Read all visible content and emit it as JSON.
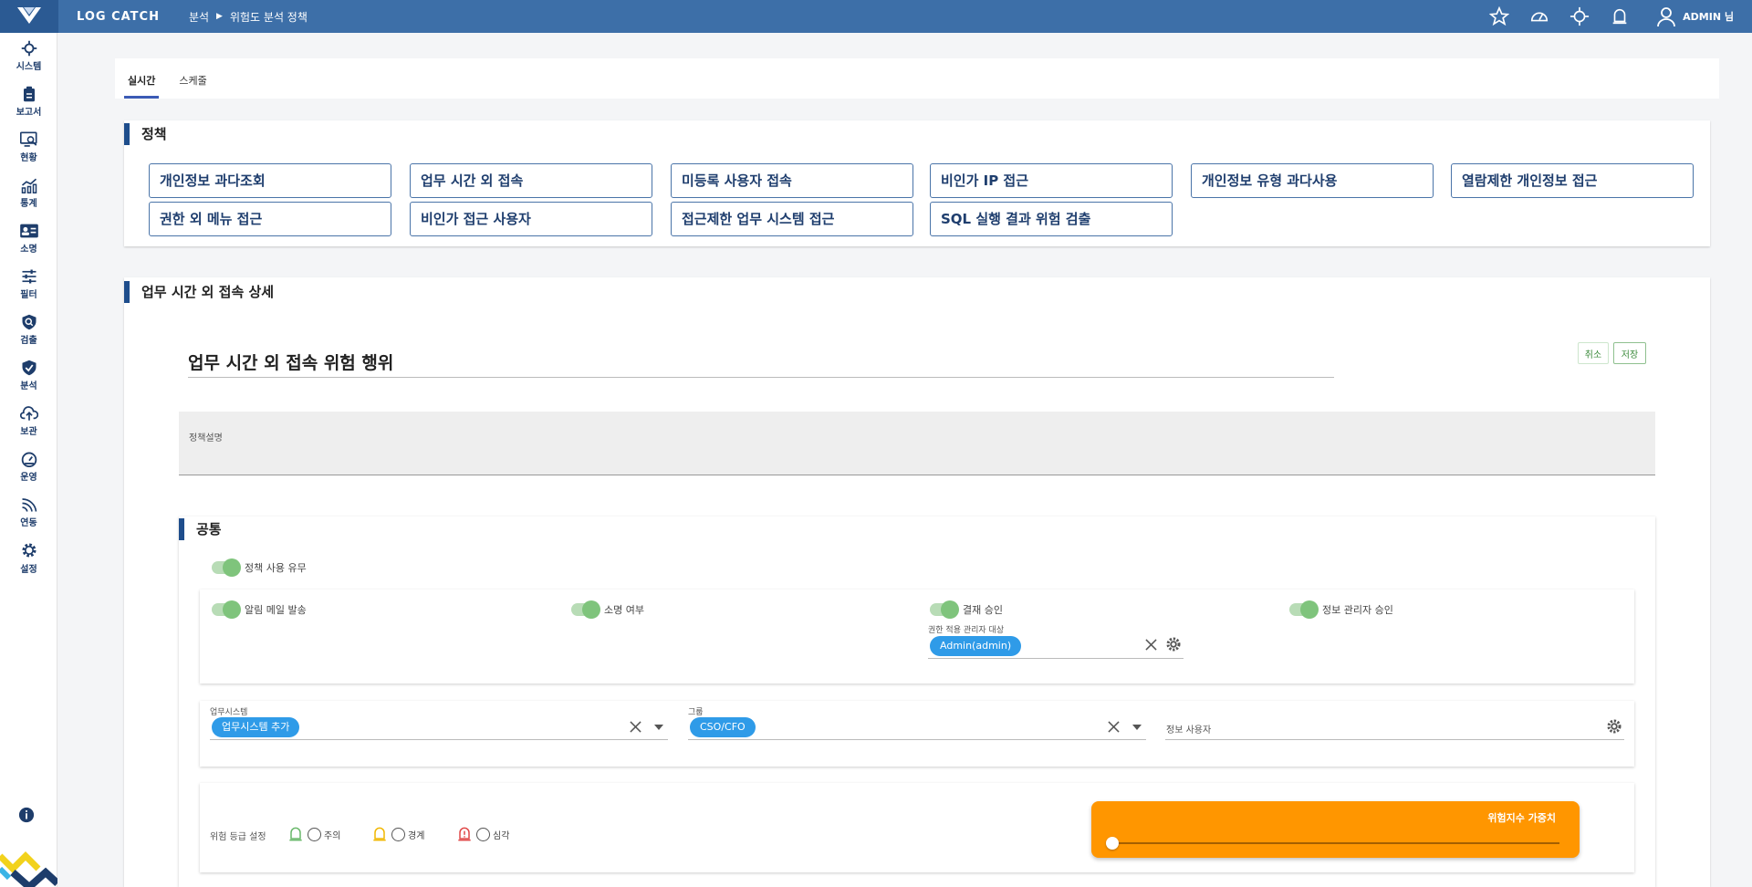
{
  "header": {
    "brand": "LOG CATCH",
    "breadcrumb": [
      "분석",
      "위험도 분석 정책"
    ],
    "user": "ADMIN 님"
  },
  "sidebar": {
    "items": [
      {
        "label": "시스템",
        "icon": "crosshair-icon"
      },
      {
        "label": "보고서",
        "icon": "clipboard-icon"
      },
      {
        "label": "현황",
        "icon": "monitor-search-icon"
      },
      {
        "label": "통계",
        "icon": "chart-icon"
      },
      {
        "label": "소명",
        "icon": "id-card-icon"
      },
      {
        "label": "필터",
        "icon": "sliders-icon"
      },
      {
        "label": "검출",
        "icon": "shield-search-icon"
      },
      {
        "label": "분석",
        "icon": "shield-check-icon"
      },
      {
        "label": "보관",
        "icon": "cloud-upload-icon"
      },
      {
        "label": "운영",
        "icon": "gauge-icon"
      },
      {
        "label": "연동",
        "icon": "signal-icon"
      },
      {
        "label": "설정",
        "icon": "gear-icon"
      }
    ]
  },
  "tabs": [
    "실시간",
    "스케줄"
  ],
  "policy_section": {
    "title": "정책",
    "buttons": [
      "개인정보 과다조회",
      "업무 시간 외 접속",
      "미등록 사용자 접속",
      "비인가 IP 접근",
      "개인정보 유형 과다사용",
      "열람제한 개인정보 접근",
      "권한 외 메뉴 접근",
      "비인가 접근 사용자",
      "접근제한 업무 시스템 접근",
      "SQL 실행 결과 위험 검출"
    ]
  },
  "detail_section": {
    "title": "업무 시간 외 접속 상세",
    "policy_name": "업무 시간 외 접속 위험 행위",
    "cancel_label": "취소",
    "save_label": "저장",
    "description_placeholder": "정책설명"
  },
  "common_section": {
    "title": "공통",
    "policy_use": "정책 사용 유무",
    "toggles": [
      "알림 메일 발송",
      "소명 여부",
      "결재 승인",
      "정보 관리자 승인"
    ],
    "approver_label": "권한 적용 관리자 대상",
    "approver_chip": "Admin(admin)",
    "system_label": "업무시스템",
    "system_chip": "업무시스템 추가",
    "group_label": "그룹",
    "group_chip": "CSO/CFO",
    "info_user_label": "정보 사용자",
    "risk_label": "위험 등급 설정",
    "risk_levels": [
      "주의",
      "경계",
      "심각"
    ],
    "weight_label": "위험지수 가중치",
    "weight_value": 0
  },
  "colors": {
    "topbar": "#3d6fa8",
    "accent": "#1e4d8c",
    "chip": "#2f9be8",
    "orange": "#ff9600",
    "toggle": "#7fc47c"
  }
}
